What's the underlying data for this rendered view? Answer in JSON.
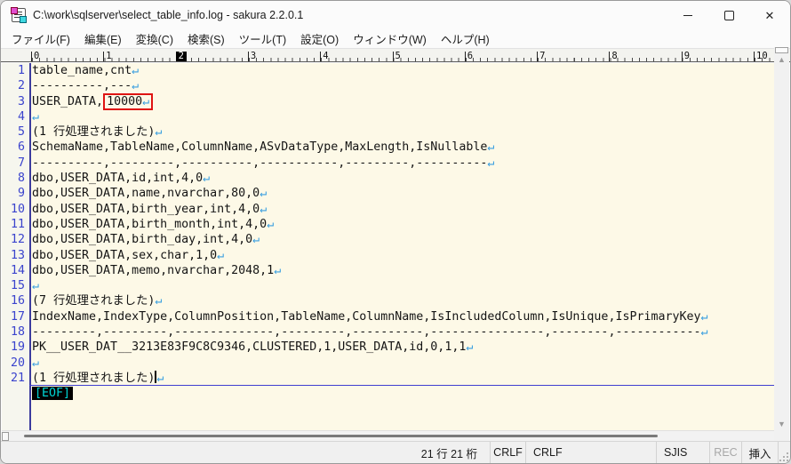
{
  "window": {
    "title": "C:\\work\\sqlserver\\select_table_info.log - sakura 2.2.0.1"
  },
  "menu": {
    "items": [
      "ファイル(F)",
      "編集(E)",
      "変換(C)",
      "検索(S)",
      "ツール(T)",
      "設定(O)",
      "ウィンドウ(W)",
      "ヘルプ(H)"
    ]
  },
  "ruler": {
    "numbers": [
      "0",
      "1",
      "2",
      "3",
      "4",
      "5",
      "6",
      "7",
      "8",
      "9",
      "10"
    ],
    "caret_number_index": 2
  },
  "editor": {
    "eol_mark": "↵",
    "eof_marker": "[EOF]",
    "lines": [
      {
        "n": 1,
        "segments": [
          {
            "t": "table_name,cnt"
          }
        ],
        "eol": true
      },
      {
        "n": 2,
        "segments": [
          {
            "t": "----------,---"
          }
        ],
        "eol": true
      },
      {
        "n": 3,
        "segments": [
          {
            "t": "USER_DATA,"
          },
          {
            "t": "10000",
            "box": true
          }
        ],
        "eol": true,
        "eol_in_box": true
      },
      {
        "n": 4,
        "segments": [],
        "eol": true
      },
      {
        "n": 5,
        "segments": [
          {
            "t": "(1 行処理されました)"
          }
        ],
        "eol": true
      },
      {
        "n": 6,
        "segments": [
          {
            "t": "SchemaName,TableName,ColumnName,ASvDataType,MaxLength,IsNullable"
          }
        ],
        "eol": true
      },
      {
        "n": 7,
        "segments": [
          {
            "t": "----------,---------,----------,-----------,---------,----------"
          }
        ],
        "eol": true
      },
      {
        "n": 8,
        "segments": [
          {
            "t": "dbo,USER_DATA,id,int,4,0"
          }
        ],
        "eol": true
      },
      {
        "n": 9,
        "segments": [
          {
            "t": "dbo,USER_DATA,name,nvarchar,80,0"
          }
        ],
        "eol": true
      },
      {
        "n": 10,
        "segments": [
          {
            "t": "dbo,USER_DATA,birth_year,int,4,0"
          }
        ],
        "eol": true
      },
      {
        "n": 11,
        "segments": [
          {
            "t": "dbo,USER_DATA,birth_month,int,4,0"
          }
        ],
        "eol": true
      },
      {
        "n": 12,
        "segments": [
          {
            "t": "dbo,USER_DATA,birth_day,int,4,0"
          }
        ],
        "eol": true
      },
      {
        "n": 13,
        "segments": [
          {
            "t": "dbo,USER_DATA,sex,char,1,0"
          }
        ],
        "eol": true
      },
      {
        "n": 14,
        "segments": [
          {
            "t": "dbo,USER_DATA,memo,nvarchar,2048,1"
          }
        ],
        "eol": true
      },
      {
        "n": 15,
        "segments": [],
        "eol": true
      },
      {
        "n": 16,
        "segments": [
          {
            "t": "(7 行処理されました)"
          }
        ],
        "eol": true
      },
      {
        "n": 17,
        "segments": [
          {
            "t": "IndexName,IndexType,ColumnPosition,TableName,ColumnName,IsIncludedColumn,IsUnique,IsPrimaryKey"
          }
        ],
        "eol": true
      },
      {
        "n": 18,
        "segments": [
          {
            "t": "---------,---------,--------------,---------,----------,----------------,--------,------------"
          }
        ],
        "eol": true
      },
      {
        "n": 19,
        "segments": [
          {
            "t": "PK__USER_DAT__3213E83F9C8C9346,CLUSTERED,1,USER_DATA,id,0,1,1"
          }
        ],
        "eol": true
      },
      {
        "n": 20,
        "segments": [],
        "eol": true
      },
      {
        "n": 21,
        "segments": [
          {
            "t": "(1 行処理されました)"
          }
        ],
        "eol": true,
        "caret": true,
        "cursor_line": true
      }
    ]
  },
  "statusbar": {
    "position": "21 行  21 桁",
    "line_ending": "CRLF",
    "input_line_ending": "CRLF",
    "encoding": "SJIS",
    "rec": "REC",
    "insert_mode": "挿入"
  },
  "colors": {
    "editor_background": "#fdf9e7",
    "line_number": "#3a43cd",
    "gutter_separator": "#3c3c9e",
    "eol_mark": "#3a9fe0",
    "highlight_box": "#df1412",
    "cursor_line_underline": "#3f3fd0",
    "eof_background": "#000000",
    "eof_text": "#00d6d6"
  }
}
